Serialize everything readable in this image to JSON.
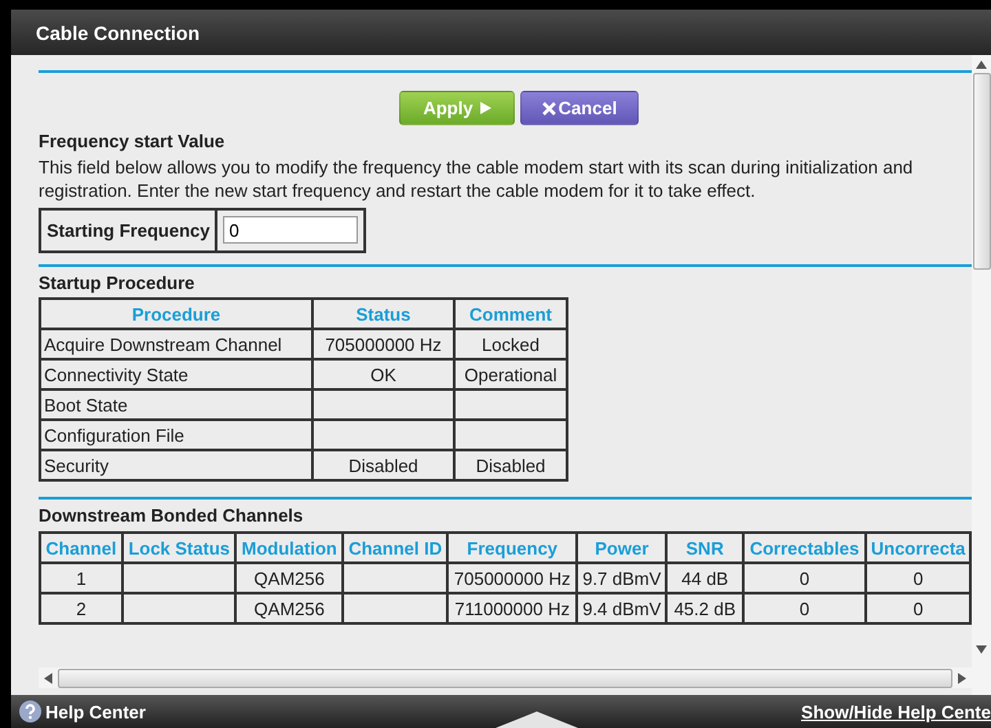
{
  "window": {
    "title": "Cable Connection"
  },
  "buttons": [
    {
      "label": "Apply",
      "kind": "apply"
    },
    {
      "label": "Cancel",
      "kind": "cancel"
    }
  ],
  "frequency_section": {
    "heading": "Frequency start Value",
    "description": "This field below allows you to modify the frequency the cable modem start with its scan during initialization and registration. Enter the new start frequency and restart the cable modem for it to take effect.",
    "field_label": "Starting Frequency",
    "field_value": "0"
  },
  "startup_procedure": {
    "heading": "Startup Procedure",
    "columns": [
      "Procedure",
      "Status",
      "Comment"
    ],
    "rows": [
      [
        "Acquire Downstream Channel",
        "705000000 Hz",
        "Locked"
      ],
      [
        "Connectivity State",
        "OK",
        "Operational"
      ],
      [
        "Boot State",
        "",
        ""
      ],
      [
        "Configuration File",
        "",
        ""
      ],
      [
        "Security",
        "Disabled",
        "Disabled"
      ]
    ]
  },
  "downstream": {
    "heading": "Downstream Bonded Channels",
    "columns": [
      "Channel",
      "Lock Status",
      "Modulation",
      "Channel ID",
      "Frequency",
      "Power",
      "SNR",
      "Correctables",
      "Uncorrecta"
    ],
    "rows": [
      [
        "1",
        "",
        "QAM256",
        "",
        "705000000 Hz",
        "9.7 dBmV",
        "44 dB",
        "0",
        "0"
      ],
      [
        "2",
        "",
        "QAM256",
        "",
        "711000000 Hz",
        "9.4 dBmV",
        "45.2 dB",
        "0",
        "0"
      ]
    ]
  },
  "footer": {
    "help": "Help Center",
    "toggle": "Show/Hide Help Cente"
  }
}
